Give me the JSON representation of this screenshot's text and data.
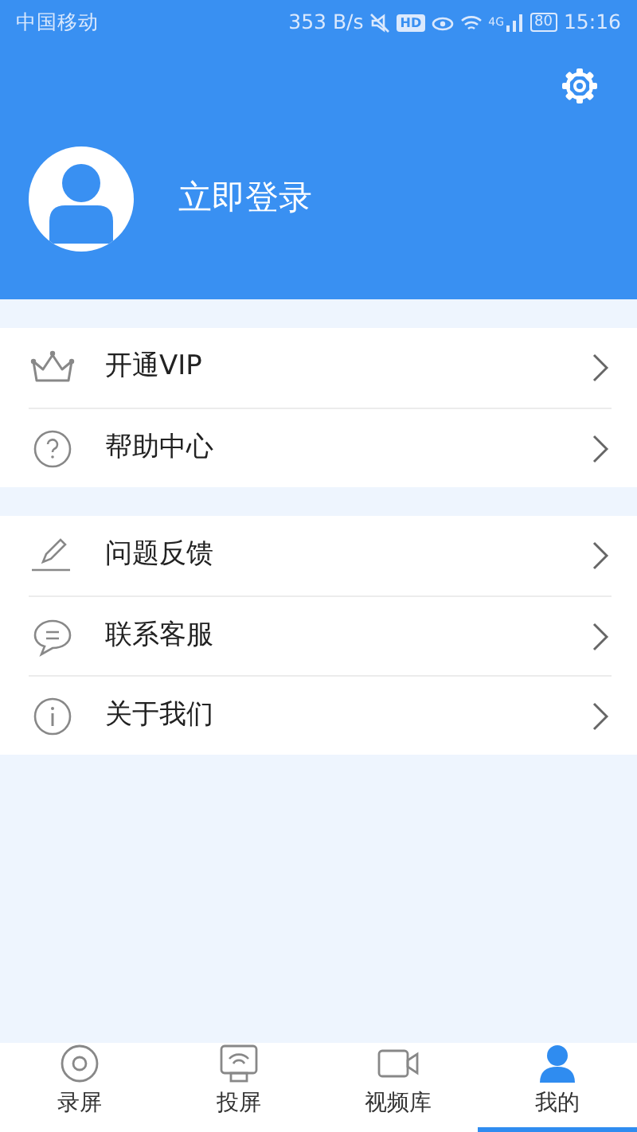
{
  "status_bar": {
    "carrier": "中国移动",
    "speed": "353 B/s",
    "hd": "HD",
    "network": "4G",
    "battery": "80",
    "time": "15:16"
  },
  "profile": {
    "login": "立即登录"
  },
  "menu_groups": [
    {
      "items": [
        {
          "kind": "crown",
          "label": "开通VIP"
        },
        {
          "kind": "help",
          "label": "帮助中心"
        }
      ]
    },
    {
      "items": [
        {
          "kind": "edit",
          "label": "问题反馈"
        },
        {
          "kind": "chat",
          "label": "联系客服"
        },
        {
          "kind": "info",
          "label": "关于我们"
        }
      ]
    }
  ],
  "tabs": [
    {
      "kind": "record",
      "label": "录屏",
      "selected": false
    },
    {
      "kind": "cast",
      "label": "投屏",
      "selected": false
    },
    {
      "kind": "video",
      "label": "视频库",
      "selected": false
    },
    {
      "kind": "me",
      "label": "我的",
      "selected": true
    }
  ]
}
